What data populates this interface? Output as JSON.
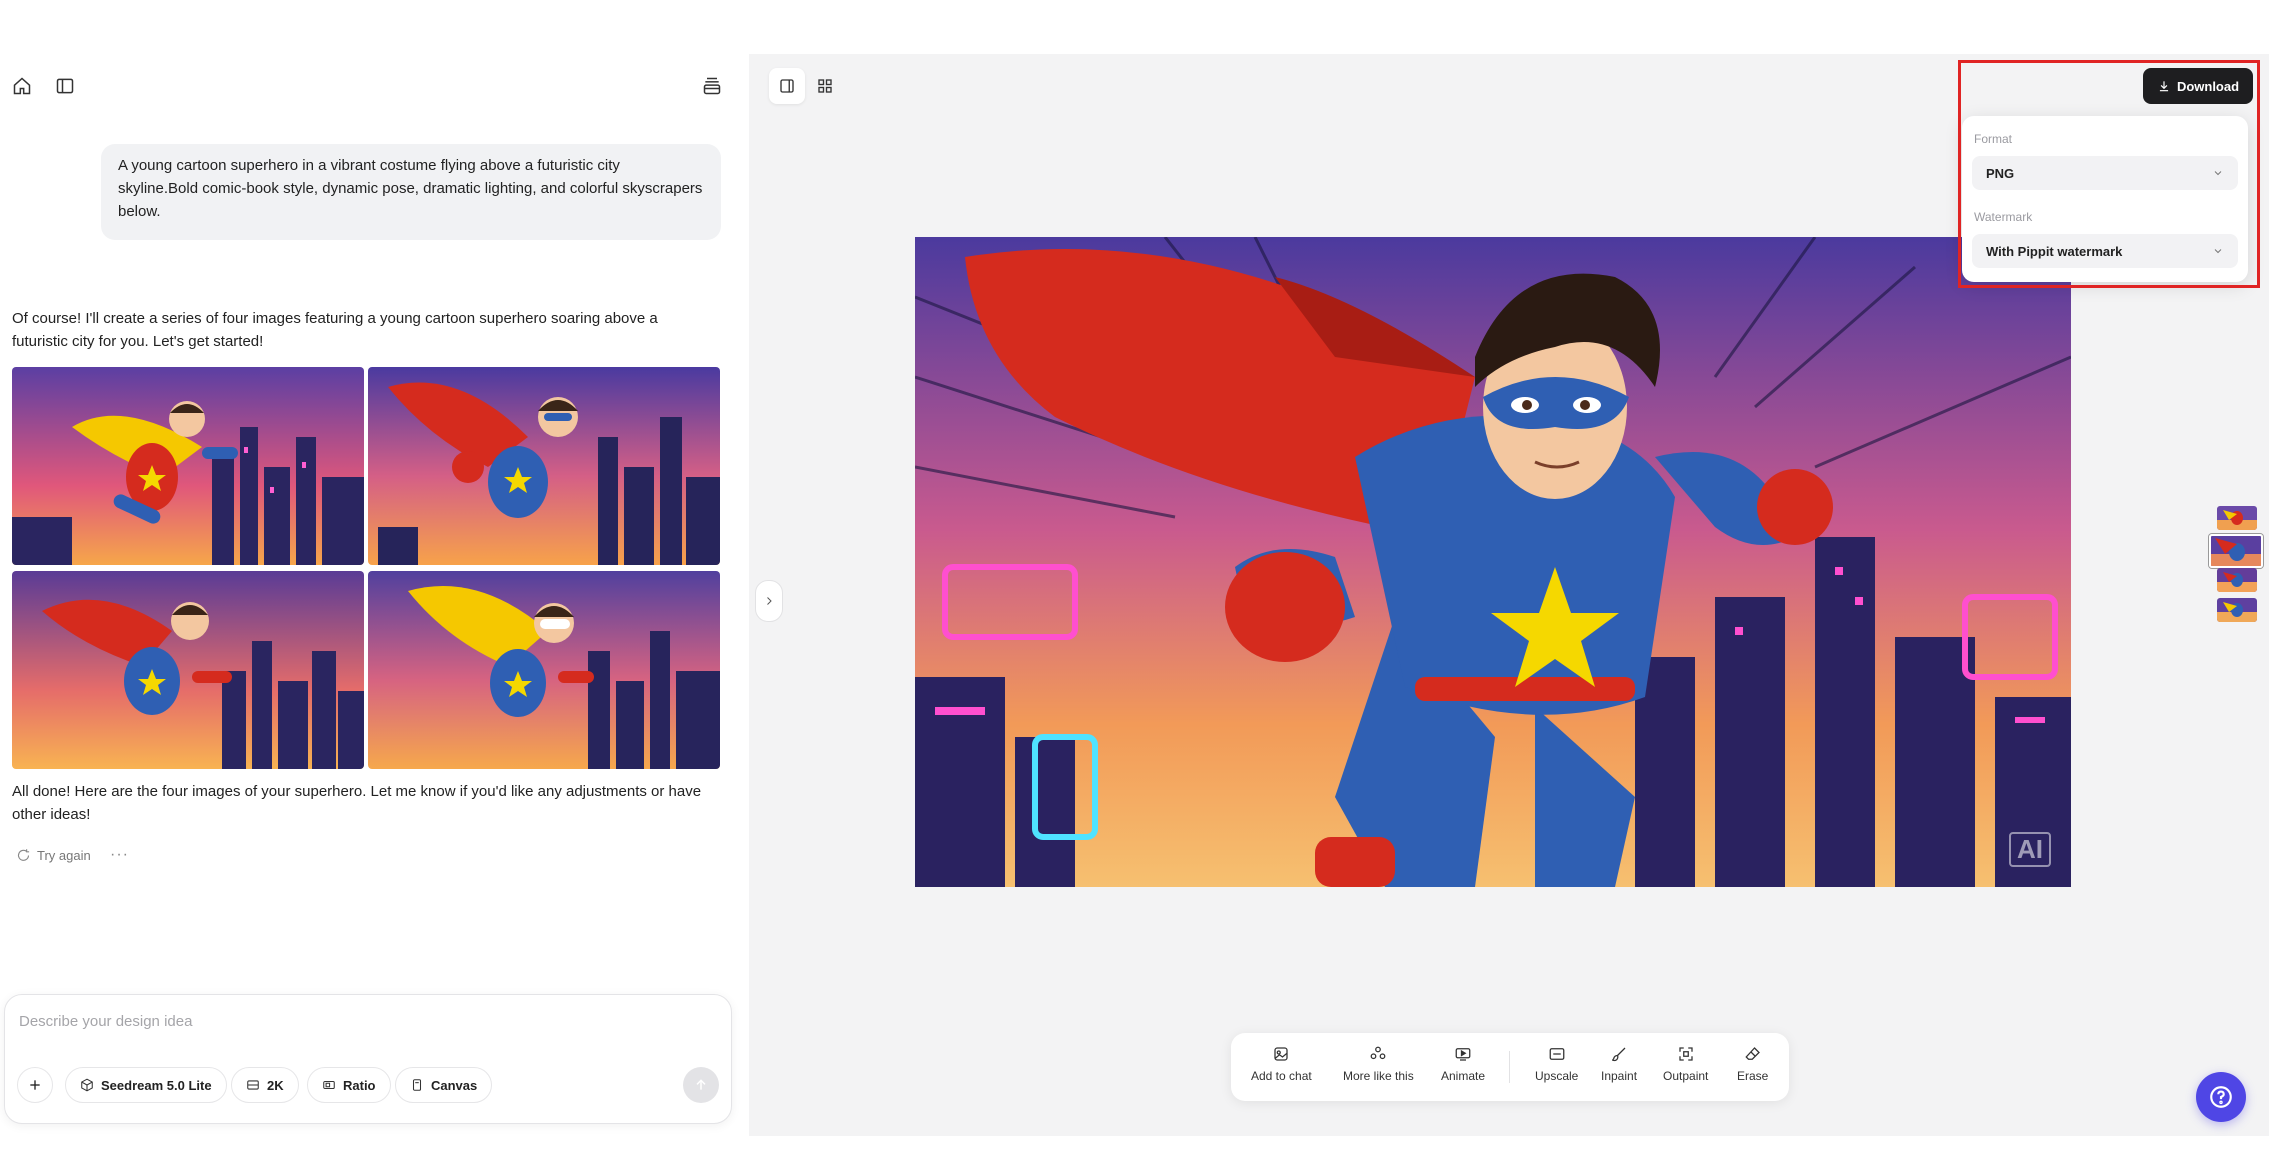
{
  "chat": {
    "prompt": "A young cartoon superhero in a vibrant costume flying above a futuristic city skyline.Bold comic-book style, dynamic pose, dramatic lighting, and colorful skyscrapers below.",
    "reply_intro": "Of course! I'll create a series of four images featuring a young cartoon superhero soaring above a futuristic city for you. Let's get started!",
    "reply_outro": "All done! Here are the four images of your superhero. Let me know if you'd like any adjustments or have other ideas!",
    "try_again": "Try again",
    "more": "···"
  },
  "composer": {
    "placeholder": "Describe your design idea",
    "model": "Seedream 5.0 Lite",
    "resolution": "2K",
    "ratio": "Ratio",
    "canvas": "Canvas"
  },
  "download": {
    "button": "Download",
    "format_label": "Format",
    "format_value": "PNG",
    "watermark_label": "Watermark",
    "watermark_value": "With Pippit watermark"
  },
  "image_badge": "AI",
  "toolbar": {
    "add_to_chat": "Add to chat",
    "more_like_this": "More like this",
    "animate": "Animate",
    "upscale": "Upscale",
    "inpaint": "Inpaint",
    "outpaint": "Outpaint",
    "erase": "Erase"
  },
  "colors": {
    "accent": "#4f46e5",
    "highlight": "#e02424",
    "download_bg": "#1e1e20",
    "hero_blue": "#2f5fb3",
    "hero_red": "#d52b1e",
    "star_yellow": "#f5d800"
  }
}
